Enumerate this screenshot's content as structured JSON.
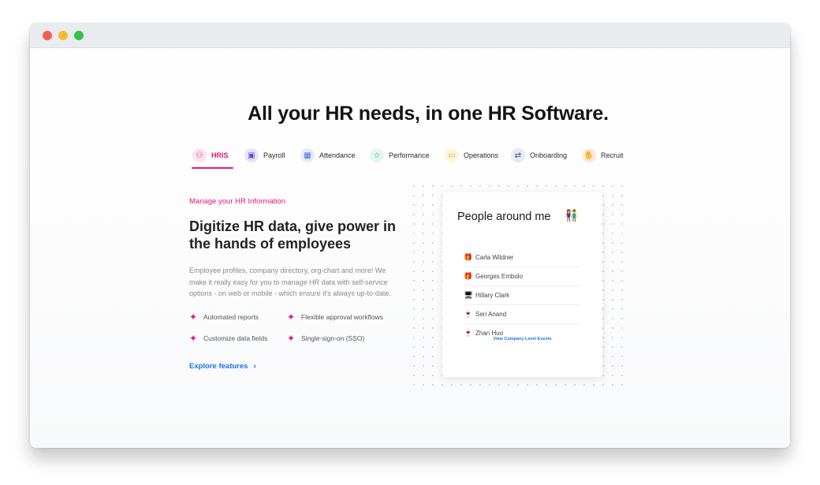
{
  "headline": "All your HR needs, in one HR Software.",
  "tabs": [
    {
      "label": "HRIS",
      "icon": "user-profile-icon",
      "glyph": "⚇",
      "icon_bg": "#fde3ef",
      "icon_fg": "#e5177b"
    },
    {
      "label": "Payroll",
      "icon": "payroll-icon",
      "glyph": "▣",
      "icon_bg": "#e7e5fb",
      "icon_fg": "#5b4fd6"
    },
    {
      "label": "Attendance",
      "icon": "calendar-icon",
      "glyph": "▦",
      "icon_bg": "#e4ecfb",
      "icon_fg": "#4a6fd8"
    },
    {
      "label": "Performance",
      "icon": "star-icon",
      "glyph": "☆",
      "icon_bg": "#e3f6f2",
      "icon_fg": "#1aa385"
    },
    {
      "label": "Operations",
      "icon": "folder-icon",
      "glyph": "▭",
      "icon_bg": "#fff5dc",
      "icon_fg": "#e0a322"
    },
    {
      "label": "Onboarding",
      "icon": "onboarding-icon",
      "glyph": "⇄",
      "icon_bg": "#e6eaf2",
      "icon_fg": "#2f4f86"
    },
    {
      "label": "Recruit",
      "icon": "recruit-icon",
      "glyph": "✋",
      "icon_bg": "#fde7e3",
      "icon_fg": "#e0503a"
    }
  ],
  "section": {
    "eyebrow": "Manage your HR Information",
    "title": "Digitize HR data, give power in the hands of employees",
    "description": "Employee profiles, company directory, org-chart and more! We make it really easy for you to manage HR data with self-service options - on web or mobile - which ensure it's always up-to-date.",
    "features": [
      "Automated reports",
      "Flexible approval workflows",
      "Customize data fields",
      "Single-sign-on (SSO)"
    ],
    "explore_label": "Explore features"
  },
  "card": {
    "title": "People around me",
    "people": [
      {
        "name": "Carla Wildner",
        "icon": "gift-icon",
        "glyph": "🎁"
      },
      {
        "name": "Georges Embolo",
        "icon": "gift-icon",
        "glyph": "🎁"
      },
      {
        "name": "Hillary Clark",
        "icon": "laptop-icon",
        "glyph": "🖥"
      },
      {
        "name": "Seri Anand",
        "icon": "glass-icon",
        "glyph": "🍷"
      },
      {
        "name": "Zhan Huo",
        "icon": "glass-icon",
        "glyph": "🍷"
      }
    ],
    "view_link": "View Company Level Events"
  },
  "colors": {
    "accent": "#e5177b",
    "link": "#1a73e8"
  }
}
